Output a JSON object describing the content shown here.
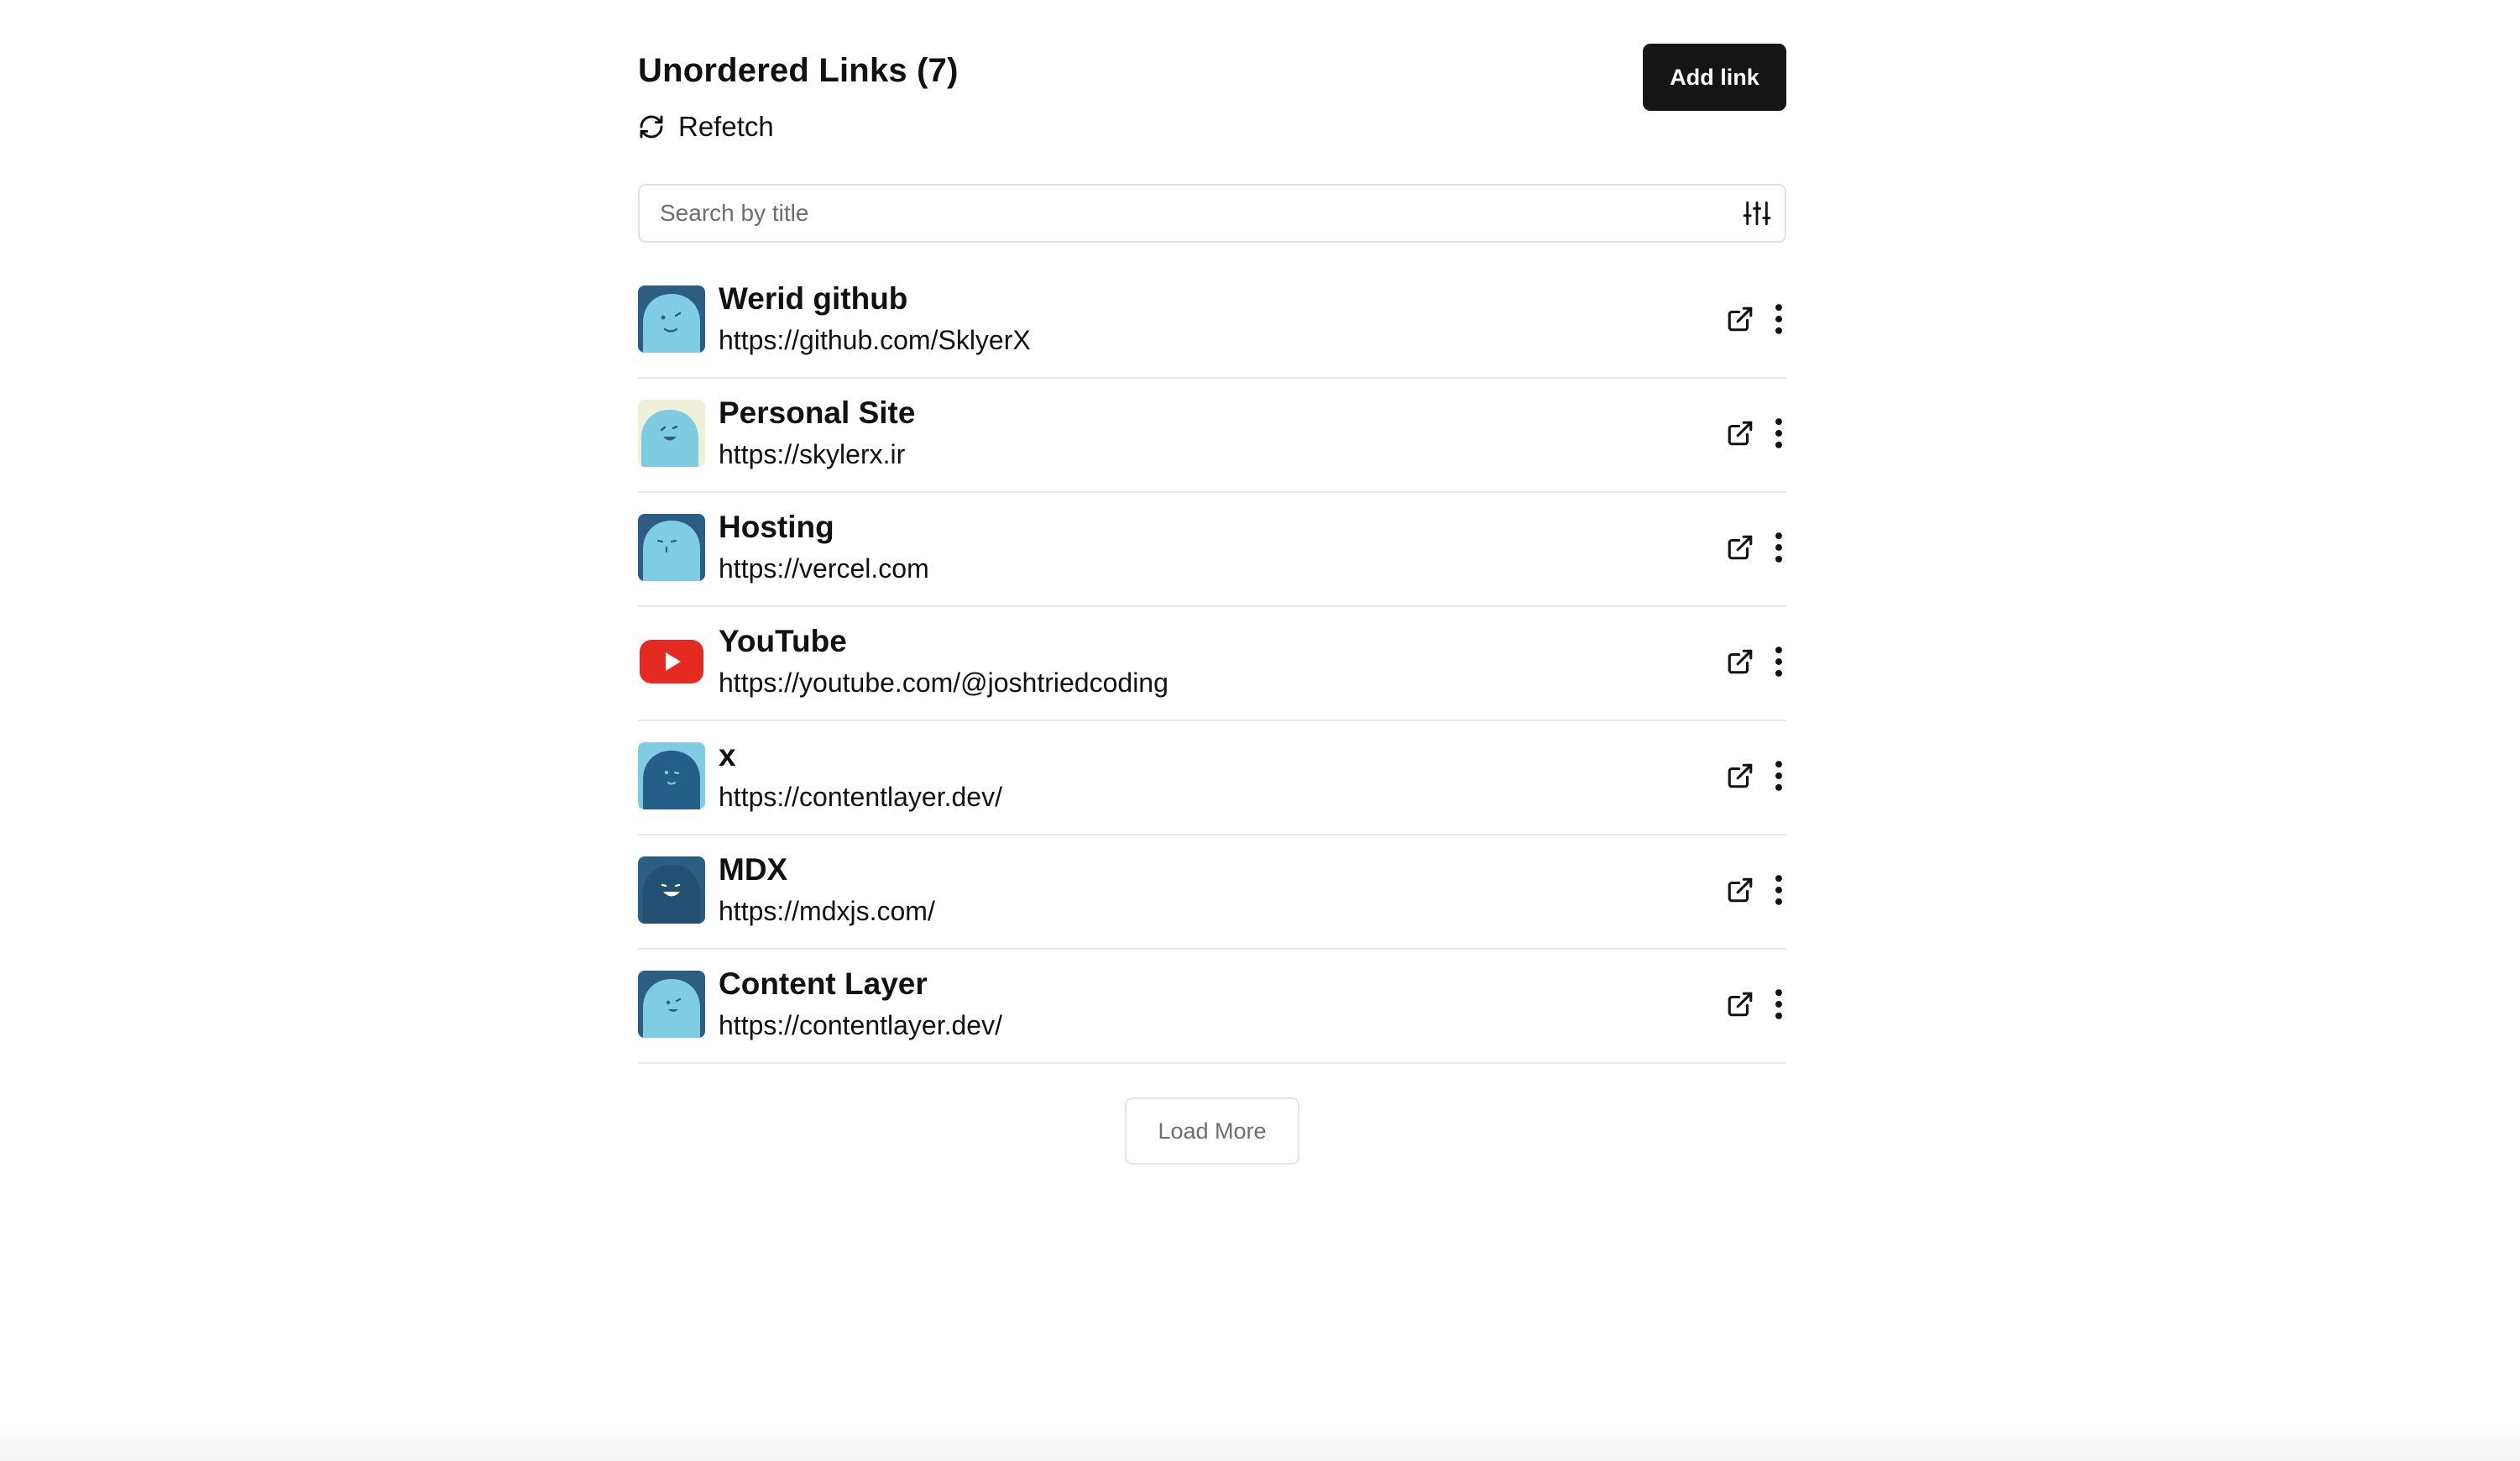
{
  "header": {
    "title": "Unordered Links (7)",
    "refetch_label": "Refetch",
    "add_button_label": "Add link"
  },
  "search": {
    "placeholder": "Search by title",
    "value": ""
  },
  "links": [
    {
      "title": "Werid github",
      "url": "https://github.com/SklyerX",
      "avatar": "light-blue-ghost"
    },
    {
      "title": "Personal Site",
      "url": "https://skylerx.ir",
      "avatar": "smiling-blue-ghost"
    },
    {
      "title": "Hosting",
      "url": "https://vercel.com",
      "avatar": "sleepy-blue-ghost"
    },
    {
      "title": "YouTube",
      "url": "https://youtube.com/@joshtriedcoding",
      "avatar": "youtube-logo"
    },
    {
      "title": "x",
      "url": "https://contentlayer.dev/",
      "avatar": "dark-blue-ghost"
    },
    {
      "title": "MDX",
      "url": "https://mdxjs.com/",
      "avatar": "dark-happy-ghost"
    },
    {
      "title": "Content Layer",
      "url": "https://contentlayer.dev/",
      "avatar": "light-happy-ghost"
    }
  ],
  "load_more_label": "Load More",
  "colors": {
    "primary_button": "#151515",
    "border": "#e2e2e2",
    "muted_text": "#6e6e6e",
    "ghost_light": "#7dcbe2",
    "ghost_dark": "#235f88",
    "youtube_red": "#e82323"
  }
}
